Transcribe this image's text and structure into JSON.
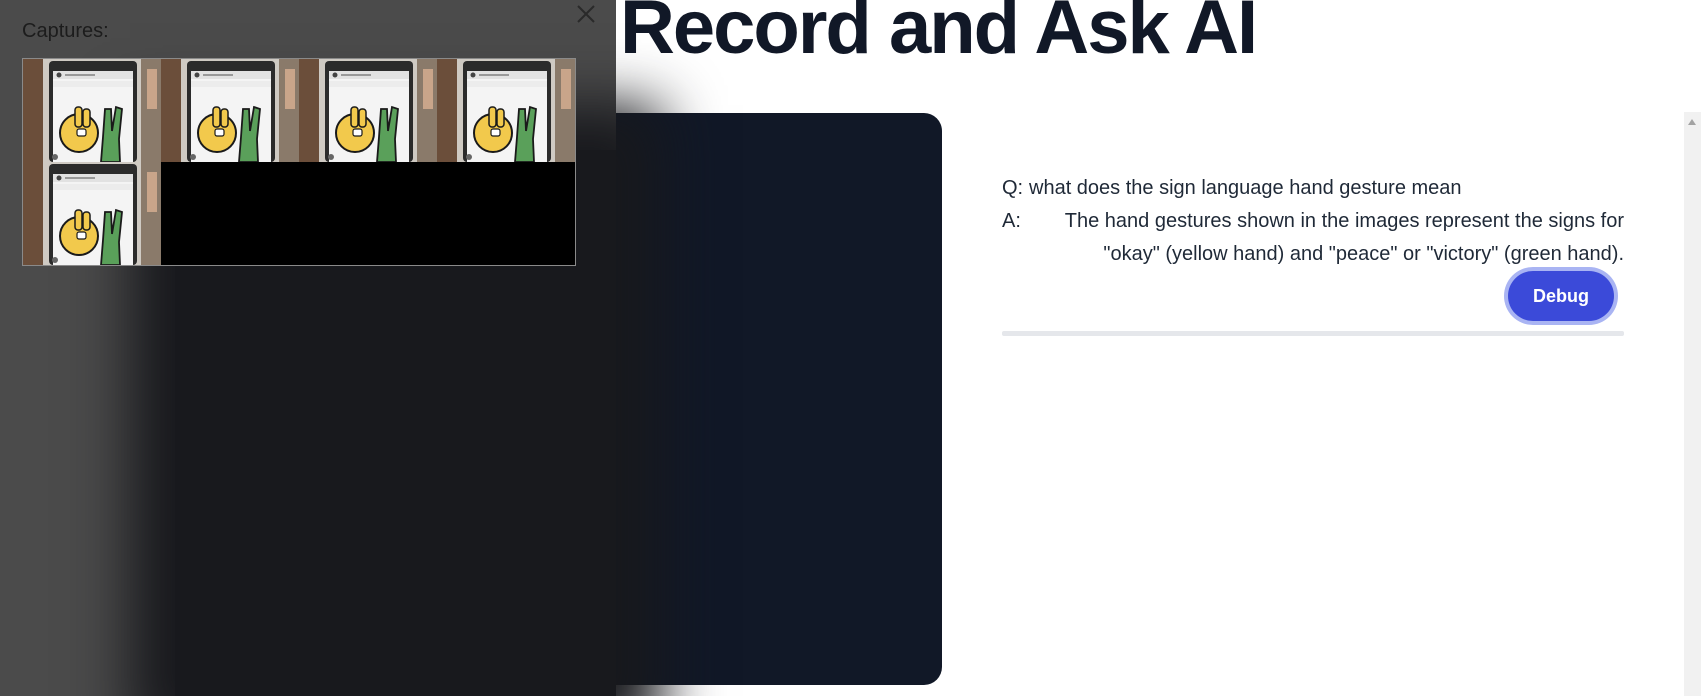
{
  "page": {
    "title": "Record and Ask AI"
  },
  "qa": {
    "question_prefix": "Q:",
    "question": "what does the sign language hand gesture mean",
    "answer_prefix": "A:",
    "answer_line1": "The hand gestures shown in the images represent the signs for",
    "answer_line2": "\"okay\" (yellow hand) and \"peace\" or \"victory\" (green hand)."
  },
  "debug_button": {
    "label": "Debug",
    "color": "#3b4ad9"
  },
  "captures": {
    "label": "Captures:",
    "close_icon": "close-icon",
    "thumbnails": [
      {
        "description": "yellow okay hand and green peace hand on phone screen"
      },
      {
        "description": "yellow okay hand and green peace hand on phone screen"
      },
      {
        "description": "yellow okay hand and green peace hand on phone screen"
      },
      {
        "description": "yellow okay hand and green peace hand on phone screen"
      },
      {
        "description": "yellow okay hand and green peace hand on phone screen"
      }
    ]
  },
  "colors": {
    "video_panel": "#111827",
    "drawer": "#4b4b4b",
    "heading": "#111827"
  }
}
